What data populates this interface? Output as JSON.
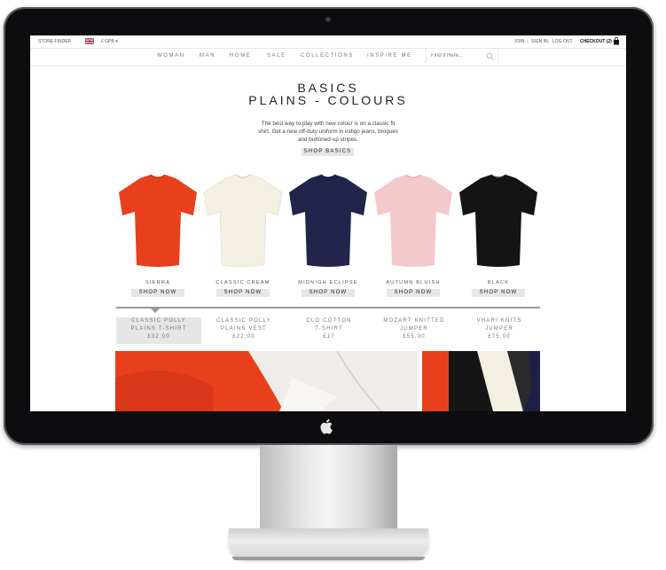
{
  "topbar": {
    "store_finder": "STORE FINDER",
    "currency": "£ GPB ▾",
    "join": "JOIN",
    "sign_in": "SIGN IN",
    "log_out": "LOG OUT",
    "checkout": "CHECKOUT (2)",
    "sep": "|"
  },
  "nav": {
    "items": [
      "WOMAN",
      "MAN",
      "HOME",
      "SALE",
      "COLLECTIONS",
      "INSPIRE ME"
    ],
    "search_placeholder": "Find it Here..."
  },
  "hero": {
    "title_line1": "BASICS",
    "title_line2": "PLAINS - COLOURS",
    "description": "The best way to play with new colour is on a classic fit shirt. Get a new off-duty uniform in indigo jeans, brogues and buttoned-up stripes.",
    "shop_button": "SHOP BASICS"
  },
  "shirts": [
    {
      "name": "SIERRA",
      "button": "SHOP NOW",
      "color": "#e8401c"
    },
    {
      "name": "CLASSIC CREAM",
      "button": "SHOP NOW",
      "color": "#f3efe2"
    },
    {
      "name": "MIDNIGH ECLIPSE",
      "button": "SHOP NOW",
      "color": "#23244b"
    },
    {
      "name": "AUTUMN BLUISH",
      "button": "SHOP NOW",
      "color": "#f3c9cc"
    },
    {
      "name": "BLACK",
      "button": "SHOP NOW",
      "color": "#141414"
    }
  ],
  "products": [
    {
      "line1": "CLASSIC POLLY",
      "line2": "PLAINS T-SHIRT",
      "price": "£32.00",
      "active": true
    },
    {
      "line1": "CLASSIC POLLY",
      "line2": "PLAINS VEST",
      "price": "£22.00",
      "active": false
    },
    {
      "line1": "CLO COTTON",
      "line2": "T-SHIRT",
      "price": "£17",
      "active": false
    },
    {
      "line1": "MOZART KNITTED",
      "line2": "JUMPER",
      "price": "£55.00",
      "active": false
    },
    {
      "line1": "VHARI KNITS",
      "line2": "JUMPER",
      "price": "£75.00",
      "active": false
    }
  ],
  "icons": {
    "flag": "uk-flag-icon",
    "bag": "shopping-bag-icon",
    "search": "search-icon",
    "apple": "apple-logo-icon"
  },
  "colors": {
    "accent_gray": "#e6e6e6",
    "text_dark": "#222222",
    "orange": "#e8401c",
    "navy": "#23244b"
  }
}
